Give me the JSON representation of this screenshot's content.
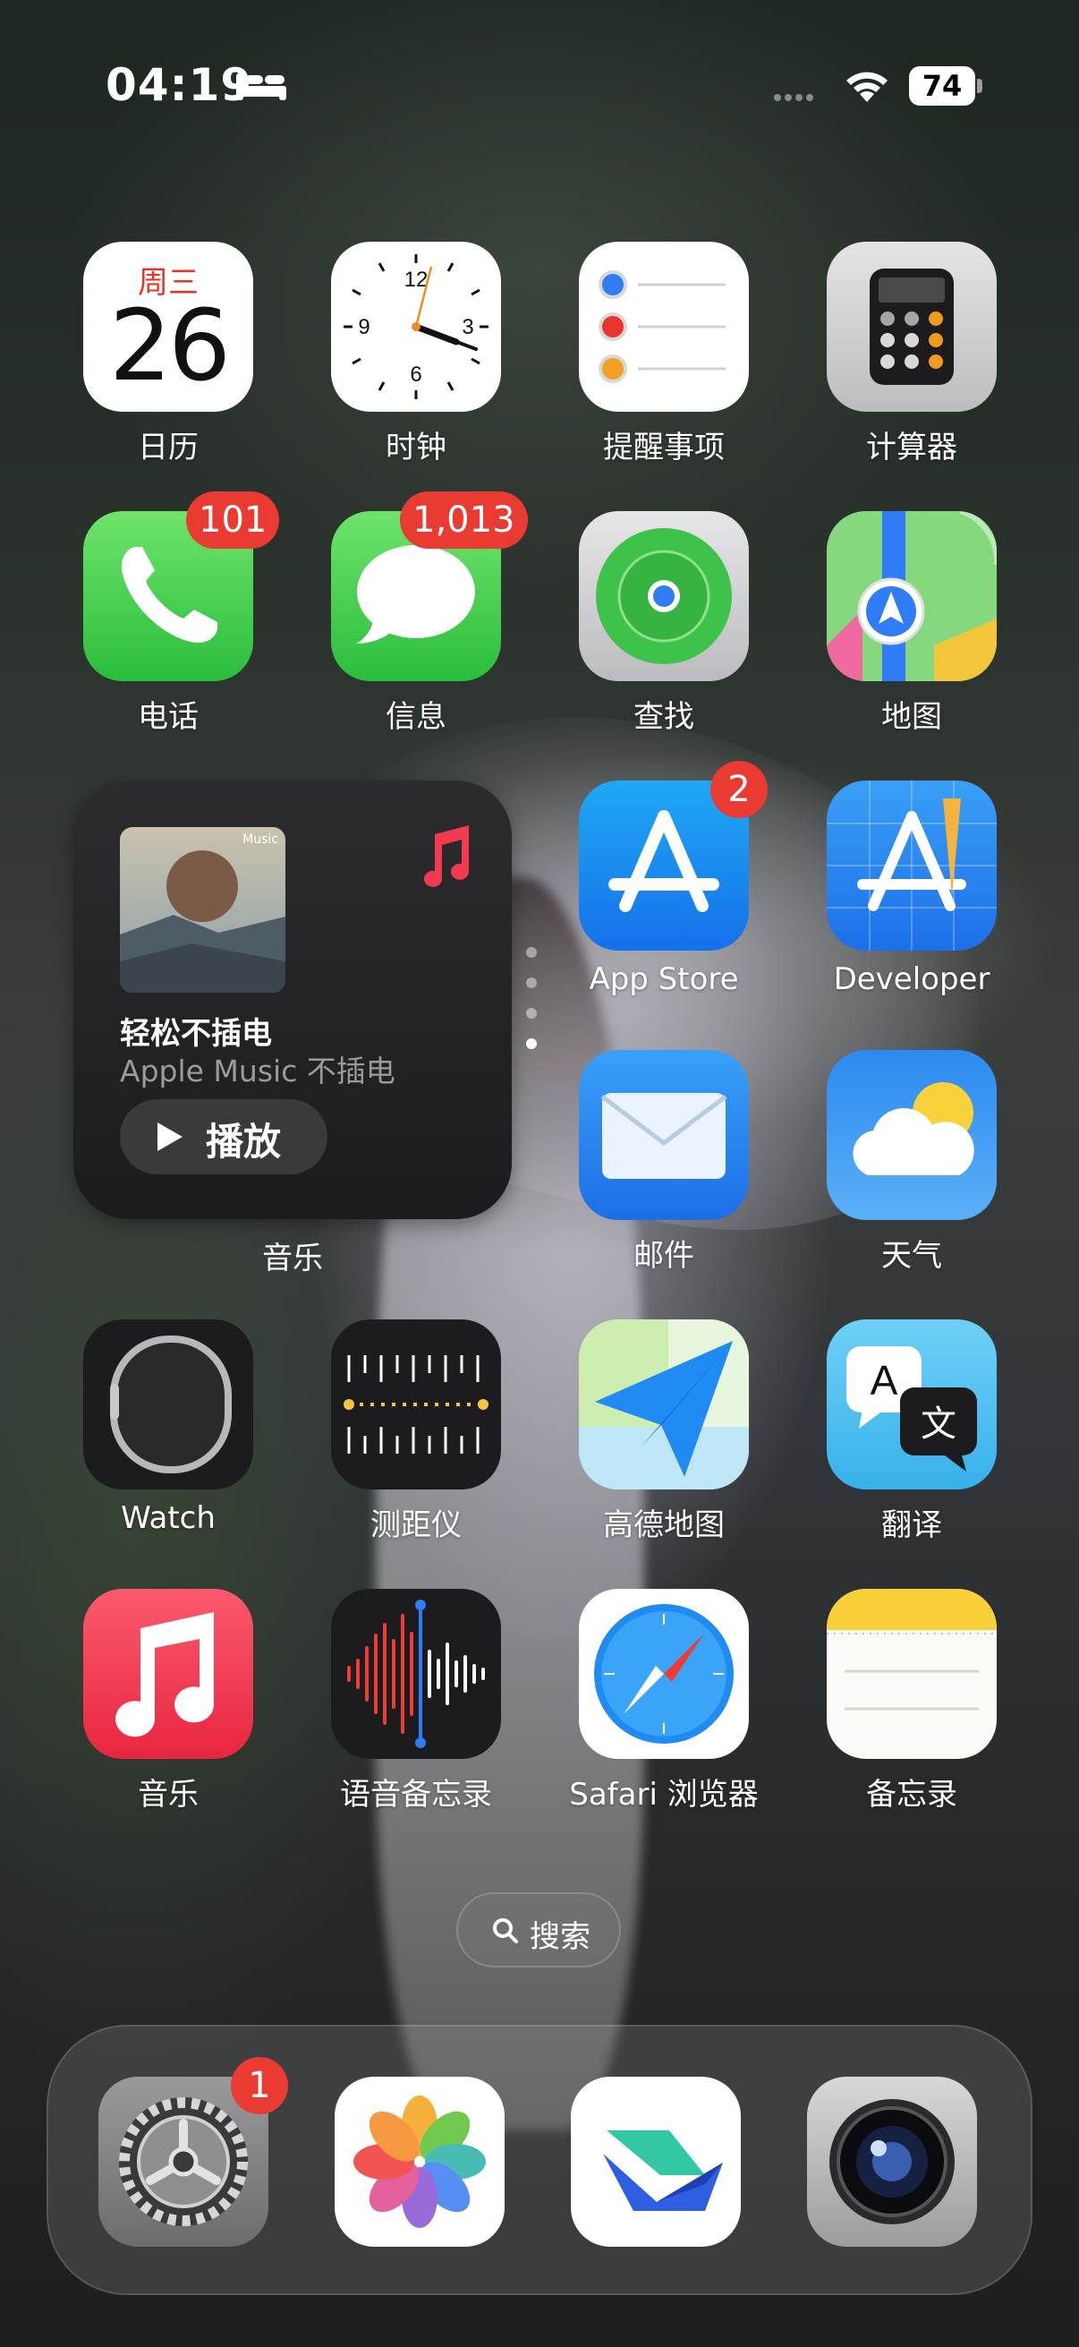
{
  "status_bar": {
    "time": "04:19",
    "battery": "74"
  },
  "apps": {
    "calendar": {
      "label": "日历",
      "weekday": "周三",
      "day": "26"
    },
    "clock": {
      "label": "时钟",
      "n12": "12",
      "n3": "3",
      "n6": "6",
      "n9": "9"
    },
    "reminders": {
      "label": "提醒事项"
    },
    "calculator": {
      "label": "计算器"
    },
    "phone": {
      "label": "电话",
      "badge": "101"
    },
    "messages": {
      "label": "信息",
      "badge": "1,013"
    },
    "findmy": {
      "label": "查找"
    },
    "maps": {
      "label": "地图"
    },
    "appstore": {
      "label": "App Store",
      "badge": "2"
    },
    "developer": {
      "label": "Developer"
    },
    "mail": {
      "label": "邮件"
    },
    "weather": {
      "label": "天气"
    },
    "watch": {
      "label": "Watch"
    },
    "measure": {
      "label": "测距仪"
    },
    "amap": {
      "label": "高德地图"
    },
    "translate": {
      "label": "翻译",
      "glyph_a": "A",
      "glyph_wen": "文"
    },
    "music": {
      "label": "音乐"
    },
    "voicememos": {
      "label": "语音备忘录"
    },
    "safari": {
      "label": "Safari 浏览器"
    },
    "notes": {
      "label": "备忘录"
    }
  },
  "music_widget": {
    "album_tag": "Music",
    "title": "轻松不插电",
    "subtitle": "Apple Music 不插电",
    "play_label": "播放",
    "widget_label": "音乐"
  },
  "search": {
    "label": "搜索"
  },
  "dock": {
    "settings_badge": "1"
  },
  "colors": {
    "badge": "#ea3b33",
    "calendar_red": "#e8352c"
  }
}
